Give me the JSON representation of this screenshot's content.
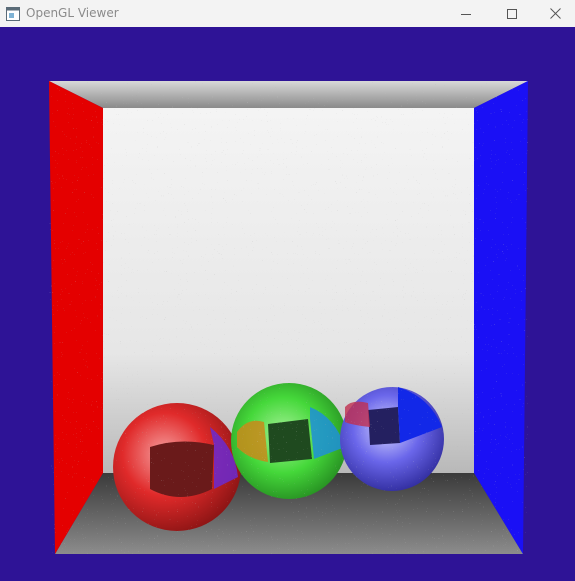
{
  "window": {
    "title": "OpenGL Viewer",
    "icon": "app-window-icon",
    "controls": {
      "minimize_icon": "minimize-icon",
      "maximize_icon": "maximize-icon",
      "close_icon": "close-icon"
    }
  },
  "scene": {
    "background_color": "#2e1396",
    "walls": {
      "left_color": "#e40000",
      "right_color": "#1a10f5",
      "back_color": "#ececec",
      "ceiling_color": "#cfcfcf",
      "floor_color": "#6a6a6a"
    },
    "spheres": [
      {
        "color": "#e32b2b"
      },
      {
        "color": "#52d83a"
      },
      {
        "color": "#5a55e0"
      }
    ]
  }
}
